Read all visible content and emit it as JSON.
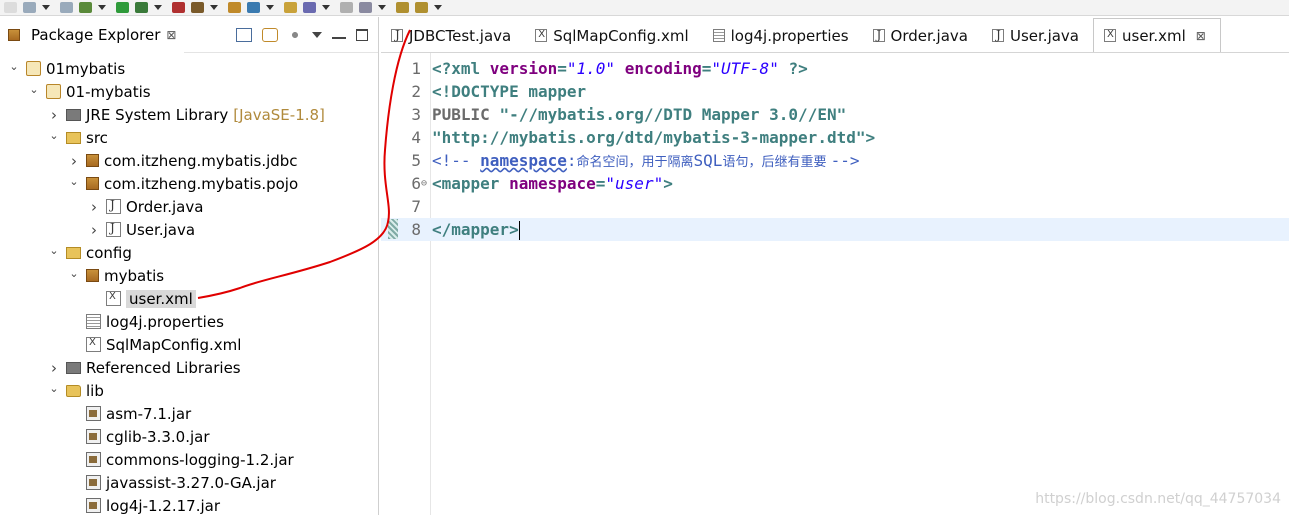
{
  "toolbar": {
    "icons": [
      "new-icon",
      "save-icon",
      "save-all-icon",
      "debug-icon",
      "run-icon",
      "coverage-icon",
      "external-tools-icon",
      "new-java-project-icon",
      "new-package-icon",
      "new-class-icon",
      "open-type-icon",
      "open-task-icon",
      "search-icon",
      "annotation-icon",
      "back-icon",
      "forward-icon"
    ]
  },
  "package_explorer": {
    "title": "Package Explorer",
    "close_glyph": "⊠",
    "tree": [
      {
        "label": "01mybatis",
        "icon": "project",
        "depth": 0,
        "expanded": true
      },
      {
        "label": "01-mybatis",
        "icon": "project",
        "depth": 1,
        "expanded": true
      },
      {
        "label": "JRE System Library",
        "decoration": "[JavaSE-1.8]",
        "icon": "library",
        "depth": 2,
        "expanded": false
      },
      {
        "label": "src",
        "icon": "source-folder",
        "depth": 2,
        "expanded": true
      },
      {
        "label": "com.itzheng.mybatis.jdbc",
        "icon": "package",
        "depth": 3,
        "expanded": false
      },
      {
        "label": "com.itzheng.mybatis.pojo",
        "icon": "package",
        "depth": 3,
        "expanded": true
      },
      {
        "label": "Order.java",
        "icon": "java",
        "depth": 4,
        "expanded": false
      },
      {
        "label": "User.java",
        "icon": "java",
        "depth": 4,
        "expanded": false
      },
      {
        "label": "config",
        "icon": "source-folder",
        "depth": 2,
        "expanded": true
      },
      {
        "label": "mybatis",
        "icon": "package-tree",
        "depth": 3,
        "expanded": true
      },
      {
        "label": "user.xml",
        "icon": "xml",
        "depth": 4,
        "selected": true
      },
      {
        "label": "log4j.properties",
        "icon": "properties",
        "depth": 3
      },
      {
        "label": "SqlMapConfig.xml",
        "icon": "xml",
        "depth": 3
      },
      {
        "label": "Referenced Libraries",
        "icon": "library",
        "depth": 2,
        "expanded": false
      },
      {
        "label": "lib",
        "icon": "folder",
        "depth": 2,
        "expanded": true
      },
      {
        "label": "asm-7.1.jar",
        "icon": "jar",
        "depth": 3
      },
      {
        "label": "cglib-3.3.0.jar",
        "icon": "jar",
        "depth": 3
      },
      {
        "label": "commons-logging-1.2.jar",
        "icon": "jar",
        "depth": 3
      },
      {
        "label": "javassist-3.27.0-GA.jar",
        "icon": "jar",
        "depth": 3
      },
      {
        "label": "log4j-1.2.17.jar",
        "icon": "jar",
        "depth": 3
      }
    ]
  },
  "editor": {
    "tabs": [
      {
        "label": "JDBCTest.java",
        "icon": "java"
      },
      {
        "label": "SqlMapConfig.xml",
        "icon": "xml"
      },
      {
        "label": "log4j.properties",
        "icon": "properties"
      },
      {
        "label": "Order.java",
        "icon": "java"
      },
      {
        "label": "User.java",
        "icon": "java"
      },
      {
        "label": "user.xml",
        "icon": "xml",
        "active": true
      }
    ],
    "close_glyph": "⊠",
    "current_line": 8,
    "lines": [
      {
        "n": "1",
        "parts": [
          [
            "kw",
            "<?xml "
          ],
          [
            "attr",
            "version"
          ],
          [
            "kw",
            "="
          ],
          [
            "val",
            "\"1.0\""
          ],
          [
            "kw",
            " "
          ],
          [
            "attr",
            "encoding"
          ],
          [
            "kw",
            "="
          ],
          [
            "val",
            "\"UTF-8\""
          ],
          [
            "kw",
            " ?>"
          ]
        ]
      },
      {
        "n": "2",
        "parts": [
          [
            "dt",
            "<!DOCTYPE mapper"
          ]
        ]
      },
      {
        "n": "3",
        "parts": [
          [
            "dtpub",
            "PUBLIC "
          ],
          [
            "str",
            "\"-//mybatis.org//DTD Mapper 3.0//EN\""
          ]
        ]
      },
      {
        "n": "4",
        "parts": [
          [
            "str",
            "\"http://mybatis.org/dtd/mybatis-3-mapper.dtd\""
          ],
          [
            "dt",
            ">"
          ]
        ]
      },
      {
        "n": "5",
        "parts": [
          [
            "cm",
            "<!-- "
          ],
          [
            "cmw",
            "namespace"
          ],
          [
            "cm",
            ":"
          ],
          [
            "cmzh",
            "命名空间，用于隔离"
          ],
          [
            "cm",
            "SQL"
          ],
          [
            "cmzh",
            "语句，后继有重要 "
          ],
          [
            "cm",
            "-->"
          ]
        ]
      },
      {
        "n": "6",
        "fold": true,
        "parts": [
          [
            "kw",
            "<mapper "
          ],
          [
            "attr",
            "namespace"
          ],
          [
            "kw",
            "="
          ],
          [
            "val",
            "\"user\""
          ],
          [
            "kw",
            ">"
          ]
        ]
      },
      {
        "n": "7",
        "parts": []
      },
      {
        "n": "8",
        "parts": [
          [
            "kw",
            "</mapper>"
          ]
        ]
      }
    ]
  },
  "watermark": "https://blog.csdn.net/qq_44757034",
  "colors": {
    "ink_annotation": "#e00000",
    "selection": "#d9d9d9",
    "current_line": "#e8f2fe"
  }
}
